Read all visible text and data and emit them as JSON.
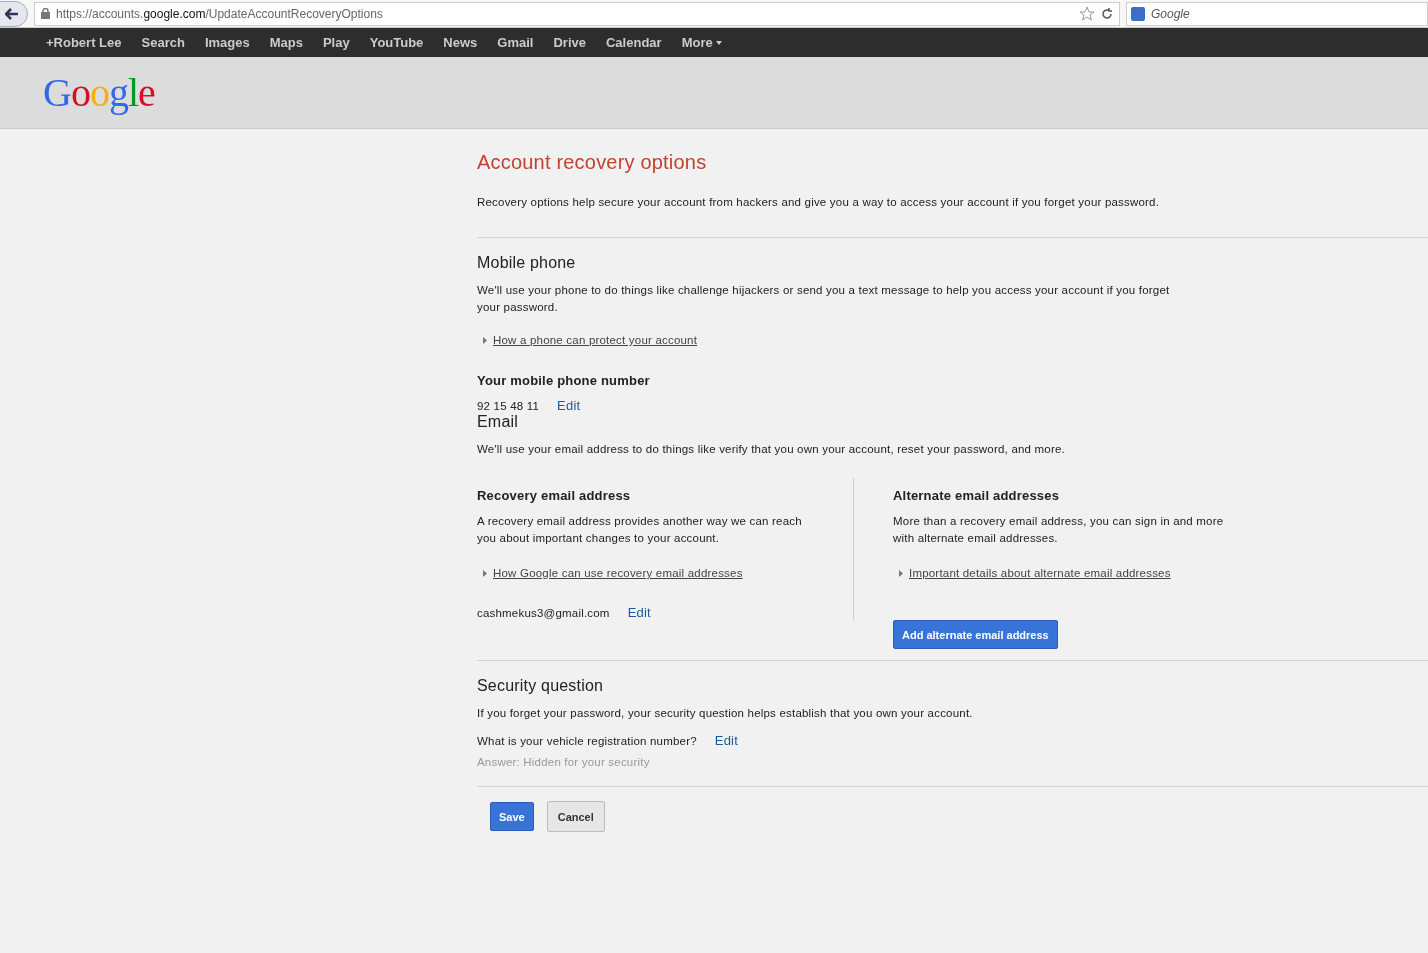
{
  "browser": {
    "url_prefix": "https://accounts.",
    "url_domain": "google.com",
    "url_path": "/UpdateAccountRecoveryOptions",
    "search_engine": "Google"
  },
  "nav": {
    "items": [
      "+Robert Lee",
      "Search",
      "Images",
      "Maps",
      "Play",
      "YouTube",
      "News",
      "Gmail",
      "Drive",
      "Calendar"
    ],
    "more": "More"
  },
  "logo": "Google",
  "page": {
    "title": "Account recovery options",
    "intro": "Recovery options help secure your account from hackers and give you a way to access your account if you forget your password."
  },
  "mobile": {
    "heading": "Mobile phone",
    "description": "We'll use your phone to do things like challenge hijackers or send you a text message to help you access your account if you forget your password.",
    "link": "How a phone can protect your account",
    "label": "Your mobile phone number",
    "value": "92 15 48 11",
    "edit": "Edit"
  },
  "email": {
    "heading": "Email",
    "description": "We'll use your email address to do things like verify that you own your account, reset your password, and more.",
    "recovery": {
      "label": "Recovery email address",
      "description": "A recovery email address provides another way we can reach you about important changes to your account.",
      "link": "How Google can use recovery email addresses",
      "value": "cashmekus3@gmail.com",
      "edit": "Edit"
    },
    "alternate": {
      "label": "Alternate email addresses",
      "description": "More than a recovery email address, you can sign in and more with alternate email addresses.",
      "link": "Important details about alternate email addresses",
      "button": "Add alternate email address"
    }
  },
  "security": {
    "heading": "Security question",
    "description": "If you forget your password, your security question helps establish that you own your account.",
    "question": "What is your vehicle registration number?",
    "edit": "Edit",
    "answer": "Answer: Hidden for your security"
  },
  "buttons": {
    "save": "Save",
    "cancel": "Cancel"
  }
}
